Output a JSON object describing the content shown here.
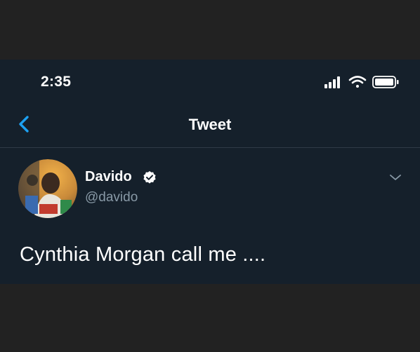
{
  "status_bar": {
    "time": "2:35",
    "icons": [
      "cellular-signal-icon",
      "wifi-icon",
      "battery-icon"
    ]
  },
  "nav": {
    "back_icon": "chevron-left-icon",
    "title": "Tweet"
  },
  "tweet": {
    "author": {
      "display_name": "Davido",
      "handle": "@davido",
      "verified_icon": "verified-badge-icon"
    },
    "menu_icon": "chevron-down-icon",
    "text": "Cynthia Morgan call me ...."
  },
  "colors": {
    "background": "#15202b",
    "outer_background": "#222222",
    "accent": "#1da1f2",
    "text_primary": "#ffffff",
    "text_secondary": "#8899a6",
    "divider": "#2f3b47"
  }
}
